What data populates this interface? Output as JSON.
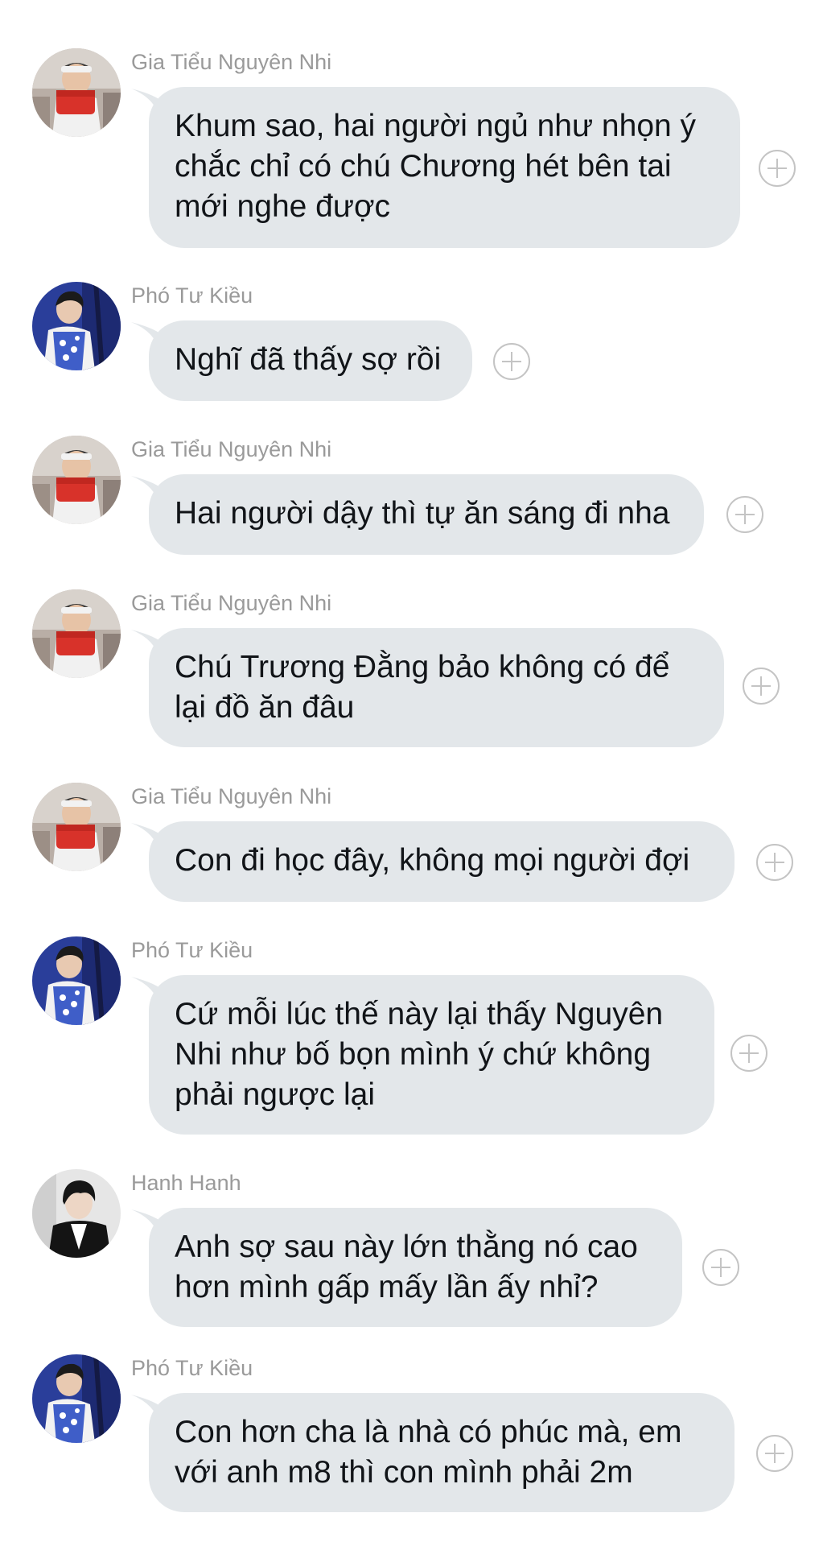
{
  "messages": [
    {
      "sender": "Gia Tiểu Nguyên Nhi",
      "avatar": "avatar-boy-red-shirt",
      "text": "Khum sao, hai người ngủ như nhọn ý\nchắc chỉ có chú Chương hét bên tai\nmới nghe được"
    },
    {
      "sender": "Phó Tư Kiều",
      "avatar": "avatar-boy-blue-vest",
      "text": "Nghĩ đã thấy sợ rồi"
    },
    {
      "sender": "Gia Tiểu Nguyên Nhi",
      "avatar": "avatar-boy-red-shirt",
      "text": "Hai người dậy thì tự ăn sáng đi nha"
    },
    {
      "sender": "Gia Tiểu Nguyên Nhi",
      "avatar": "avatar-boy-red-shirt",
      "text": "Chú Trương Đằng bảo không có để\nlại đồ ăn đâu"
    },
    {
      "sender": "Gia Tiểu Nguyên Nhi",
      "avatar": "avatar-boy-red-shirt",
      "text": "Con đi học đây, không mọi người đợi"
    },
    {
      "sender": "Phó Tư Kiều",
      "avatar": "avatar-boy-blue-vest",
      "text": "Cứ mỗi lúc thế này lại thấy Nguyên\nNhi như bố bọn mình ý chứ không\nphải ngược lại"
    },
    {
      "sender": "Hanh Hanh",
      "avatar": "avatar-young-man-dark",
      "text": "Anh sợ sau này lớn thằng nó cao\nhơn mình gấp mấy lần ấy nhỉ?"
    },
    {
      "sender": "Phó Tư Kiều",
      "avatar": "avatar-boy-blue-vest",
      "text": "Con hơn cha là nhà có phúc mà, em\nvới anh m8 thì con mình phải 2m"
    }
  ],
  "colors": {
    "bubble": "#e3e7ea",
    "sender": "#9a9a9a",
    "text": "#111418",
    "plus": "#c4c4c4"
  }
}
